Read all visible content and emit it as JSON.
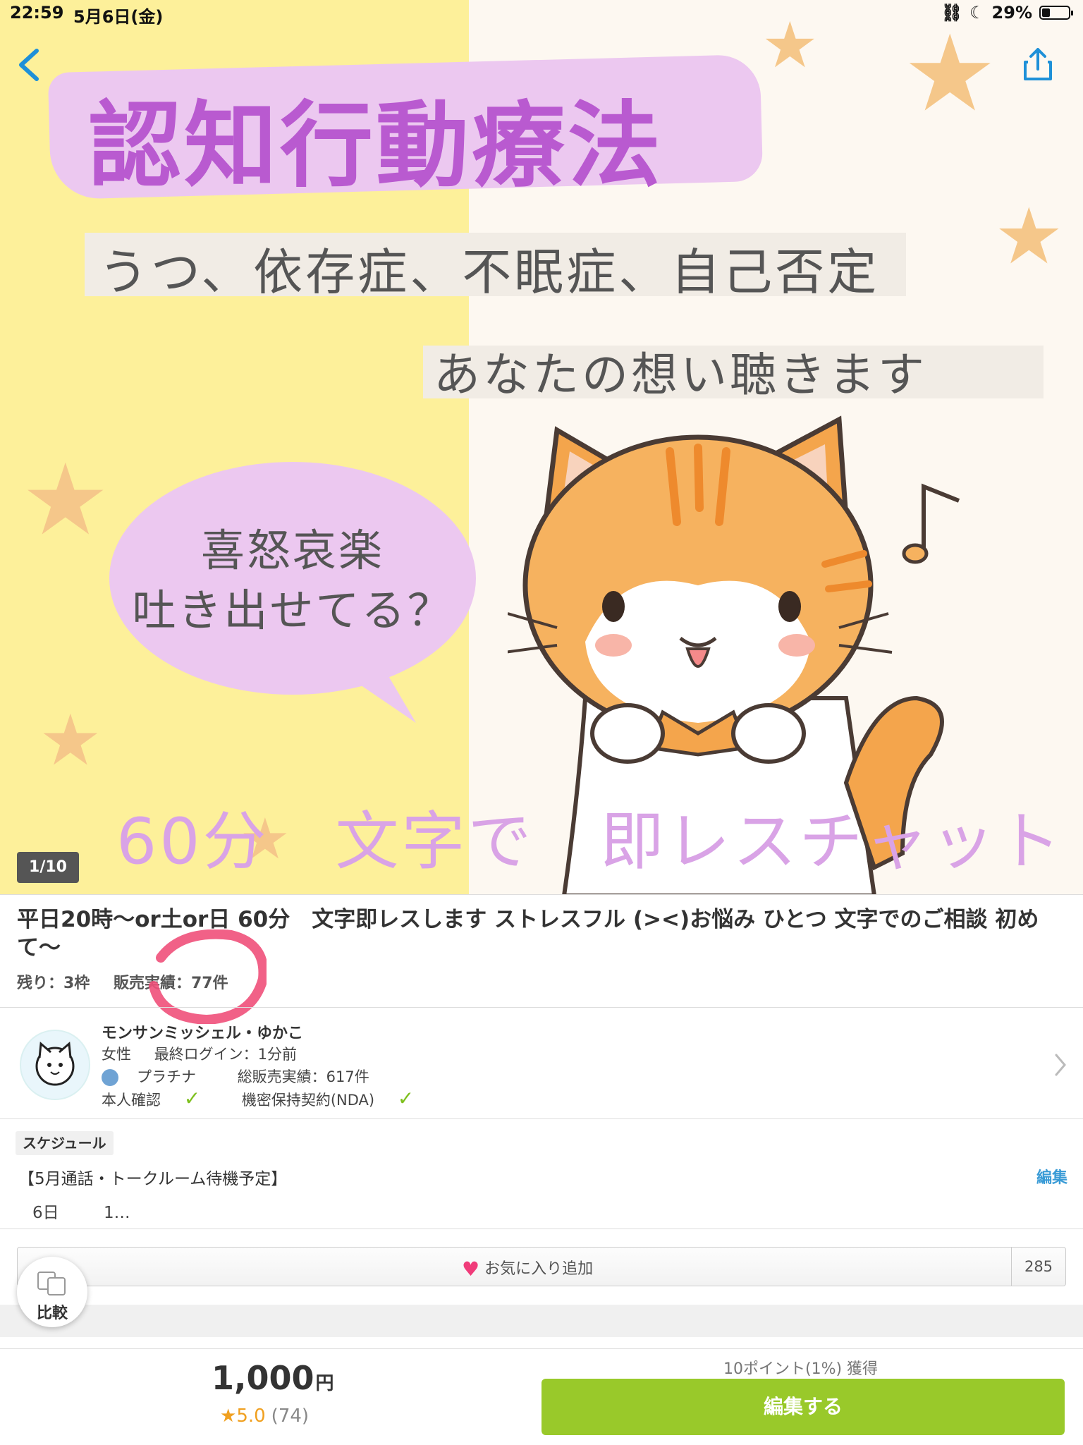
{
  "status_bar": {
    "time": "22:59",
    "date": "5月6日(金)",
    "battery": "29%"
  },
  "hero": {
    "title": "認知行動療法",
    "subtitle": "うつ、依存症、不眠症、自己否定",
    "subtitle2": "あなたの想い聴きます",
    "bubble_line1": "喜怒哀楽",
    "bubble_line2": "吐き出せてる？",
    "bottom_text": "60分　文字で　即レスチャット",
    "page_indicator": "1/10",
    "colors": {
      "left_bg": "#fdf09a",
      "right_bg": "#fdf8f1",
      "title": "#b95ad0",
      "band": "#ecc8f0"
    }
  },
  "service": {
    "title": "平日20時〜or土or日 60分　文字即レスします ストレスフル (><)お悩み ひとつ 文字でのご相談 初めて〜",
    "remaining": "残り：3枠",
    "sales": "販売実績：77件"
  },
  "seller": {
    "name": "モンサンミッシェル・ゆかこ",
    "gender": "女性",
    "last_login": "最終ログイン：1分前",
    "rank": "プラチナ",
    "total_sales": "総販売実績：617件",
    "identity": "本人確認",
    "nda": "機密保持契約(NDA)"
  },
  "schedule": {
    "tag": "スケジュール",
    "title": "【5月通話・トークルーム待機予定】",
    "edit": "編集",
    "row_day": "6日",
    "row_value": "1…"
  },
  "favorite": {
    "label": "お気に入り追加",
    "count": "285"
  },
  "compare": {
    "label": "比較"
  },
  "purchase": {
    "price": "1,000",
    "unit": "円",
    "rating": "5.0",
    "rating_count": "(74)",
    "points": "10ポイント(1%) 獲得",
    "button": "編集する",
    "button_color": "#99c92a"
  }
}
